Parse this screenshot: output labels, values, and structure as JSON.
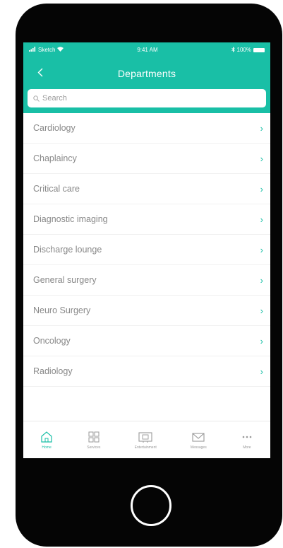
{
  "status_bar": {
    "carrier": "Sketch",
    "time": "9:41 AM",
    "battery": "100%"
  },
  "nav": {
    "title": "Departments",
    "back_icon": "chevron-left-icon"
  },
  "search": {
    "placeholder": "Search"
  },
  "departments": [
    {
      "label": "Cardiology"
    },
    {
      "label": "Chaplaincy"
    },
    {
      "label": "Critical care"
    },
    {
      "label": "Diagnostic imaging"
    },
    {
      "label": "Discharge lounge"
    },
    {
      "label": "General surgery"
    },
    {
      "label": "Neuro Surgery"
    },
    {
      "label": "Oncology"
    },
    {
      "label": "Radiology"
    }
  ],
  "tabs": [
    {
      "label": "Home",
      "icon": "home-icon",
      "active": true
    },
    {
      "label": "Services",
      "icon": "grid-icon",
      "active": false
    },
    {
      "label": "Entertainment",
      "icon": "tv-icon",
      "active": false
    },
    {
      "label": "Messages",
      "icon": "mail-icon",
      "active": false
    },
    {
      "label": "More",
      "icon": "more-icon",
      "active": false
    }
  ],
  "colors": {
    "accent": "#19bfa6",
    "phone": "#050505",
    "item_text": "#888888"
  }
}
